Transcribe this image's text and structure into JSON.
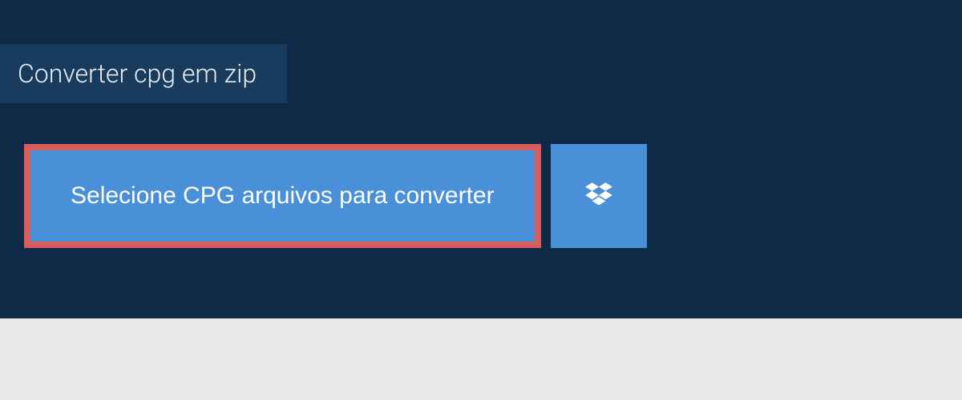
{
  "tab": {
    "title": "Converter cpg em zip"
  },
  "buttons": {
    "select_label": "Selecione CPG arquivos para converter"
  },
  "colors": {
    "panel_bg": "#0e2a47",
    "tab_bg": "#193b5e",
    "button_bg": "#4a90d9",
    "highlight_border": "#d85c5c"
  }
}
